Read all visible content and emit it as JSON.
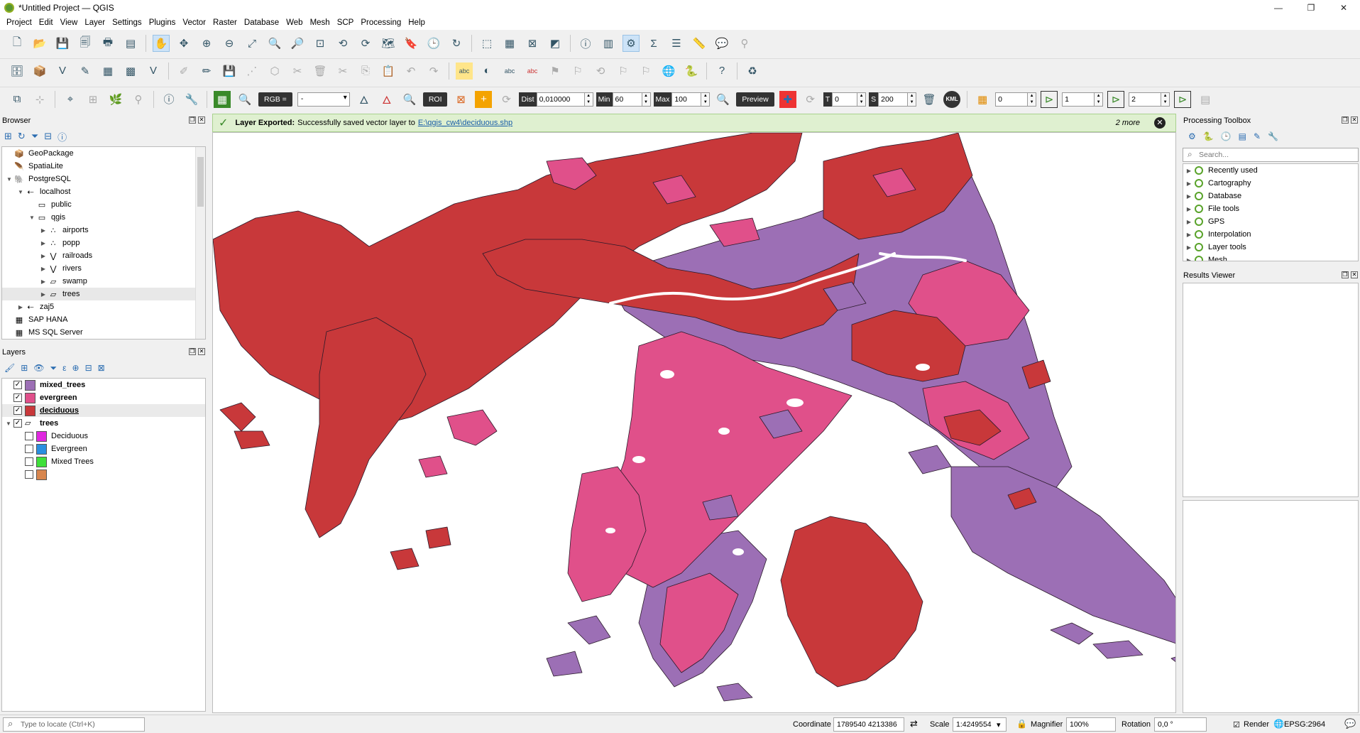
{
  "window": {
    "title": "*Untitled Project — QGIS",
    "controls": [
      "—",
      "❐",
      "✕"
    ]
  },
  "menu": [
    "Project",
    "Edit",
    "View",
    "Layer",
    "Settings",
    "Plugins",
    "Vector",
    "Raster",
    "Database",
    "Web",
    "Mesh",
    "SCP",
    "Processing",
    "Help"
  ],
  "scp_toolbar": {
    "rgb_label": "RGB =",
    "rgb_value": "-",
    "roi_label": "ROI",
    "dist_label": "Dist",
    "dist_value": "0,010000",
    "min_label": "Min",
    "min_value": "60",
    "max_label": "Max",
    "max_value": "100",
    "preview_label": "Preview",
    "t_label": "T",
    "t_value": "0",
    "s_label": "S",
    "s_value": "200",
    "kml_label": "KML",
    "band_a": "0",
    "band_b": "1",
    "band_c": "2"
  },
  "browser": {
    "title": "Browser",
    "items": [
      {
        "label": "GeoPackage",
        "indent": 0,
        "arrow": "",
        "icon": "geopackage-icon"
      },
      {
        "label": "SpatiaLite",
        "indent": 0,
        "arrow": "",
        "icon": "spatialite-icon"
      },
      {
        "label": "PostgreSQL",
        "indent": 0,
        "arrow": "▼",
        "icon": "postgresql-icon"
      },
      {
        "label": "localhost",
        "indent": 1,
        "arrow": "▼",
        "icon": "connection-icon"
      },
      {
        "label": "public",
        "indent": 2,
        "arrow": "",
        "icon": "schema-icon"
      },
      {
        "label": "qgis",
        "indent": 2,
        "arrow": "▼",
        "icon": "schema-icon"
      },
      {
        "label": "airports",
        "indent": 3,
        "arrow": "▶",
        "icon": "point-layer-icon"
      },
      {
        "label": "popp",
        "indent": 3,
        "arrow": "▶",
        "icon": "point-layer-icon"
      },
      {
        "label": "railroads",
        "indent": 3,
        "arrow": "▶",
        "icon": "line-layer-icon"
      },
      {
        "label": "rivers",
        "indent": 3,
        "arrow": "▶",
        "icon": "line-layer-icon"
      },
      {
        "label": "swamp",
        "indent": 3,
        "arrow": "▶",
        "icon": "polygon-layer-icon"
      },
      {
        "label": "trees",
        "indent": 3,
        "arrow": "▶",
        "icon": "polygon-layer-icon"
      },
      {
        "label": "zaj5",
        "indent": 1,
        "arrow": "▶",
        "icon": "connection-icon"
      },
      {
        "label": "SAP HANA",
        "indent": 0,
        "arrow": "",
        "icon": "saphana-icon"
      },
      {
        "label": "MS SQL Server",
        "indent": 0,
        "arrow": "",
        "icon": "mssql-icon"
      }
    ]
  },
  "layers": {
    "title": "Layers",
    "items": [
      {
        "label": "mixed_trees",
        "color": "#9c6fb5",
        "checked": true,
        "bold": true,
        "underline": false,
        "indent": 0,
        "arrow": ""
      },
      {
        "label": "evergreen",
        "color": "#e0508a",
        "checked": true,
        "bold": true,
        "underline": false,
        "indent": 0,
        "arrow": ""
      },
      {
        "label": "deciduous",
        "color": "#c8383a",
        "checked": true,
        "bold": true,
        "underline": true,
        "indent": 0,
        "arrow": ""
      },
      {
        "label": "trees",
        "color": "",
        "checked": true,
        "bold": true,
        "underline": false,
        "indent": 0,
        "arrow": "▼"
      },
      {
        "label": "Deciduous",
        "color": "#e028e0",
        "checked": false,
        "bold": false,
        "underline": false,
        "indent": 1,
        "arrow": ""
      },
      {
        "label": "Evergreen",
        "color": "#2a8fe0",
        "checked": false,
        "bold": false,
        "underline": false,
        "indent": 1,
        "arrow": ""
      },
      {
        "label": "Mixed Trees",
        "color": "#3fe03a",
        "checked": false,
        "bold": false,
        "underline": false,
        "indent": 1,
        "arrow": ""
      },
      {
        "label": "",
        "color": "#d8864e",
        "checked": false,
        "bold": false,
        "underline": false,
        "indent": 1,
        "arrow": ""
      }
    ]
  },
  "message": {
    "title": "Layer Exported:",
    "text": "Successfully saved vector layer to",
    "link": "E:\\qgis_cw4\\deciduous.shp",
    "more": "2 more"
  },
  "processing": {
    "title": "Processing Toolbox",
    "search_placeholder": "Search...",
    "items": [
      "Recently used",
      "Cartography",
      "Database",
      "File tools",
      "GPS",
      "Interpolation",
      "Layer tools",
      "Mesh"
    ]
  },
  "results": {
    "title": "Results Viewer"
  },
  "status": {
    "locator_placeholder": "Type to locate (Ctrl+K)",
    "coordinate_label": "Coordinate",
    "coordinate_value": "1789540  4213386",
    "scale_label": "Scale",
    "scale_value": "1:4249554",
    "magnifier_label": "Magnifier",
    "magnifier_value": "100%",
    "rotation_label": "Rotation",
    "rotation_value": "0,0 °",
    "render_label": "Render",
    "crs_label": "EPSG:2964"
  },
  "colors": {
    "mixed_trees": "#9c6fb5",
    "evergreen": "#e0508a",
    "deciduous": "#c8383a"
  }
}
